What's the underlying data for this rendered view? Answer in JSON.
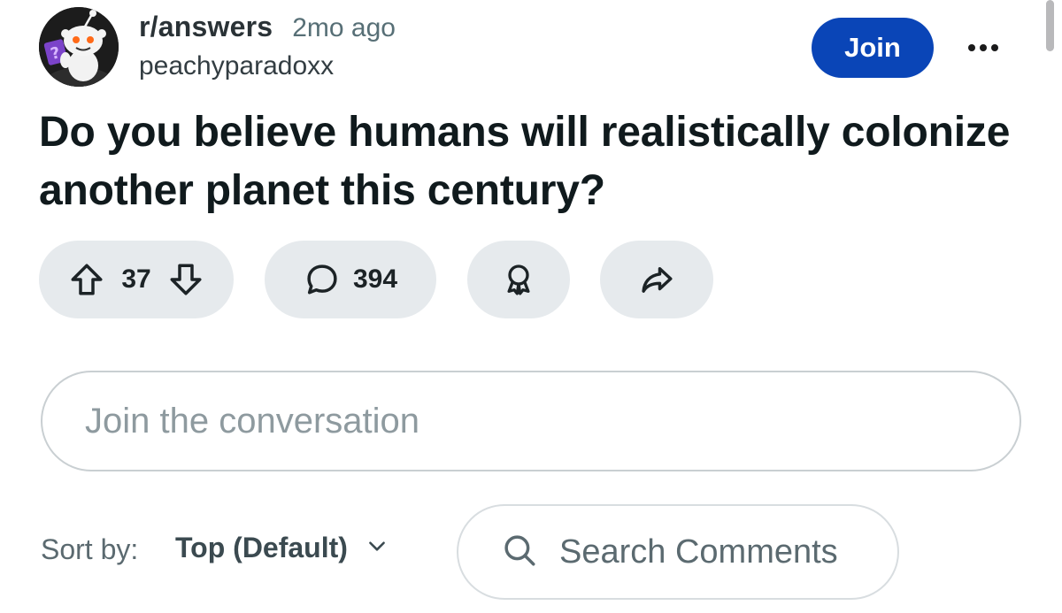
{
  "post": {
    "subreddit": "r/answers",
    "timestamp": "2mo ago",
    "author": "peachyparadoxx",
    "join_label": "Join",
    "title": "Do you believe humans will realistically colonize another planet this century?",
    "votes": "37",
    "comments": "394"
  },
  "composer": {
    "placeholder": "Join the conversation"
  },
  "sort": {
    "label": "Sort by:",
    "value": "Top (Default)"
  },
  "search": {
    "label": "Search Comments"
  },
  "icons": {
    "avatar": "snoo-avatar-icon",
    "more": "more-options-icon",
    "upvote": "upvote-arrow-icon",
    "downvote": "downvote-arrow-icon",
    "comment": "comment-bubble-icon",
    "award": "award-icon",
    "share": "share-arrow-icon",
    "chevron": "chevron-down-icon",
    "search": "search-icon"
  },
  "colors": {
    "join_button": "#0a45b7",
    "pill_background": "#e6eaed"
  }
}
